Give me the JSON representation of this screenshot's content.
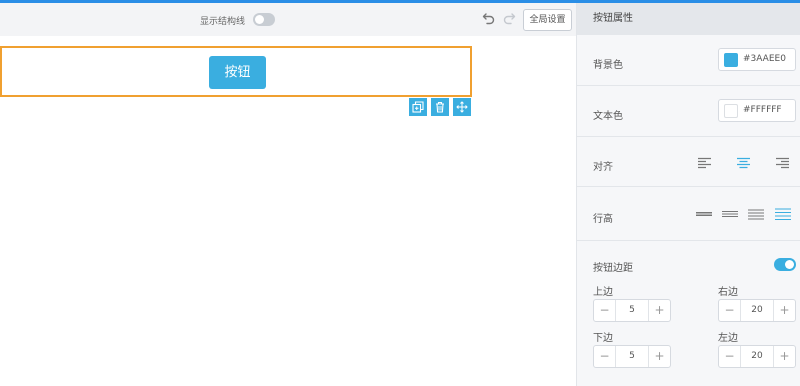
{
  "editor": {
    "show_structure_label": "显示结构线",
    "global_settings_label": "全局设置",
    "button_text": "按钮"
  },
  "panel": {
    "title": "按钮属性",
    "bg_color_label": "背景色",
    "bg_color_value": "#3AAEE0",
    "text_color_label": "文本色",
    "text_color_value": "#FFFFFF",
    "align_label": "对齐",
    "line_height_label": "行高",
    "margin_label": "按钮边距",
    "margins": {
      "top_label": "上边",
      "top_value": "5",
      "right_label": "右边",
      "right_value": "20",
      "bottom_label": "下边",
      "bottom_value": "5",
      "left_label": "左边",
      "left_value": "20"
    },
    "minus": "−",
    "plus": "+"
  },
  "colors": {
    "accent": "#3aaee0",
    "selection_border": "#f0a030",
    "top_accent": "#2a8ee6"
  }
}
